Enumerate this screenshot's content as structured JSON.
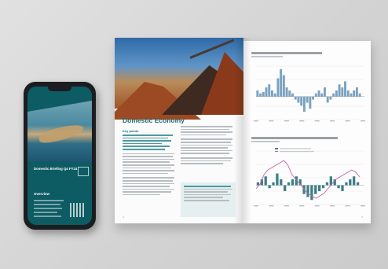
{
  "phone": {
    "brochure_title": "Domestic Briefing Q4 FY24",
    "section_label": "Overview"
  },
  "brochure": {
    "left_page": {
      "heading": "Domestic Economy",
      "section_label": "Key points",
      "page_number_left": "4"
    },
    "right_page": {
      "page_number_right": "5"
    }
  },
  "colors": {
    "accent_teal": "#1f6b73",
    "bar_blue": "#7aa2bf",
    "bar_teal": "#3d7f86",
    "line_pink": "#c95fa5"
  },
  "chart_data": [
    {
      "type": "bar",
      "values": [
        2,
        1,
        1.5,
        3,
        4,
        2,
        1,
        6,
        9,
        7,
        3,
        2,
        1,
        -1,
        -2,
        -3,
        -5,
        -2,
        -4,
        -1,
        1,
        2,
        1,
        3,
        -2,
        -1,
        1,
        2,
        4,
        3,
        5,
        2,
        1,
        2,
        3,
        1
      ]
    },
    {
      "type": "bar",
      "bars": [
        1,
        2,
        3,
        -1,
        1,
        4,
        2,
        -2,
        1,
        2,
        3,
        2,
        -3,
        -4,
        -5,
        -3,
        -2,
        -1,
        1,
        3,
        2,
        -1,
        -2,
        1,
        2,
        3,
        1
      ],
      "line": [
        3,
        4,
        6,
        7,
        7.5,
        8,
        8.5,
        9,
        8,
        6,
        5,
        4,
        3,
        2,
        1.5,
        1,
        1.5,
        2,
        3,
        4,
        5,
        5.5,
        6,
        6.5,
        7,
        6.5,
        5.5
      ]
    }
  ]
}
